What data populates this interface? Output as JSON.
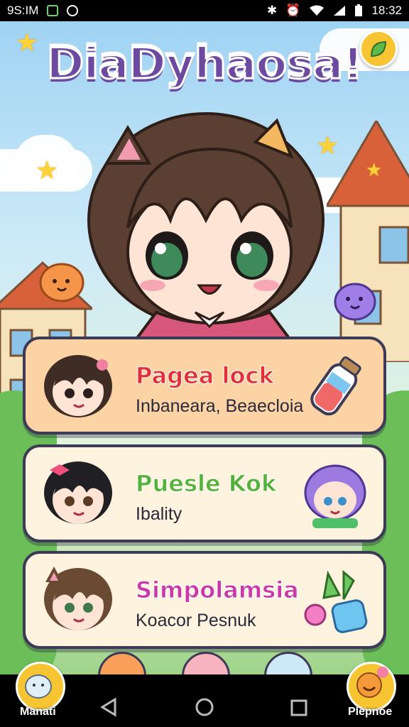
{
  "status_bar": {
    "time_left": "9S:IM",
    "time_right": "18:32"
  },
  "game": {
    "title": "DiaDyhaosa!"
  },
  "cards": [
    {
      "name": "Pagea lock",
      "subtitle": "Inbaneara, Beaecloia",
      "name_color": "#e0303a",
      "bg": "#fbd3a4"
    },
    {
      "name": "Puesle Kok",
      "subtitle": "Ibality",
      "name_color": "#52b23a",
      "bg": "#fdf3df"
    },
    {
      "name": "Simpolamsia",
      "subtitle": "Koacor Pesnuk",
      "name_color": "#c93aa6",
      "bg": "#fdf3df"
    }
  ],
  "bottom_menu": {
    "left_label": "Manati",
    "right_label": "Plepnoe"
  },
  "icons": [
    "wifi-icon",
    "battery-icon",
    "back-icon",
    "home-icon",
    "recents-icon"
  ]
}
